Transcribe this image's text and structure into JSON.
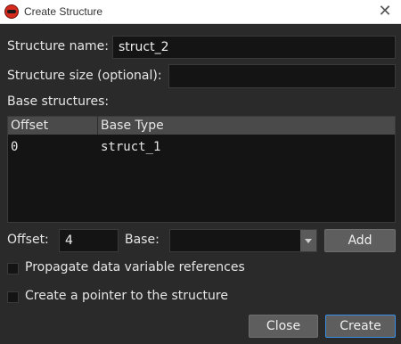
{
  "window": {
    "title": "Create Structure",
    "close_glyph": "✕"
  },
  "form": {
    "name_label": "Structure name:",
    "name_value": "struct_2",
    "size_label": "Structure size (optional):",
    "size_value": "",
    "base_label": "Base structures:"
  },
  "table": {
    "columns": [
      "Offset",
      "Base Type"
    ],
    "rows": [
      {
        "offset": "0",
        "base_type": "struct_1"
      }
    ]
  },
  "add_row": {
    "offset_label": "Offset:",
    "offset_value": "4",
    "base_label": "Base:",
    "base_value": "",
    "add_button": "Add"
  },
  "options": {
    "propagate_label": "Propagate data variable references",
    "propagate_checked": false,
    "pointer_label": "Create a pointer to the structure",
    "pointer_checked": false
  },
  "buttons": {
    "close": "Close",
    "create": "Create"
  },
  "colors": {
    "background": "#2a2a2a",
    "field_background": "#141414",
    "header_background": "#4a4a4a",
    "button_background": "#5e5e5e",
    "focus_border": "#3a8ee6",
    "app_icon": "#d62b1e"
  }
}
